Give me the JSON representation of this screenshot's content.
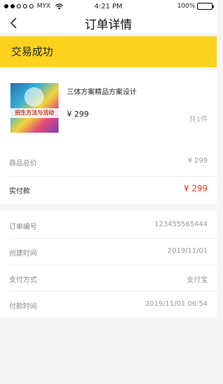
{
  "status_bar": {
    "carrier": "MYX",
    "time": "4:21 PM",
    "battery": "100%",
    "battery_level": 1.0
  },
  "nav": {
    "title": "订单详情"
  },
  "order_status": "交易成功",
  "product": {
    "name": "三体方案精品方案设计",
    "price": "¥ 299",
    "quantity": "共1件",
    "thumb_text": "招生方法与活动"
  },
  "summary": {
    "subtotal_label": "商品总价",
    "subtotal_value": "¥ 299",
    "paid_label": "实付款",
    "paid_value": "¥ 299"
  },
  "info": [
    {
      "label": "订单编号",
      "value": "123455565444"
    },
    {
      "label": "创建时间",
      "value": "2019/11/01"
    },
    {
      "label": "支付方式",
      "value": "支付宝"
    },
    {
      "label": "付款时间",
      "value": "2019/11/01 06:54"
    }
  ],
  "colors": {
    "accent": "#fcd21c",
    "price_red": "#e5372f"
  }
}
